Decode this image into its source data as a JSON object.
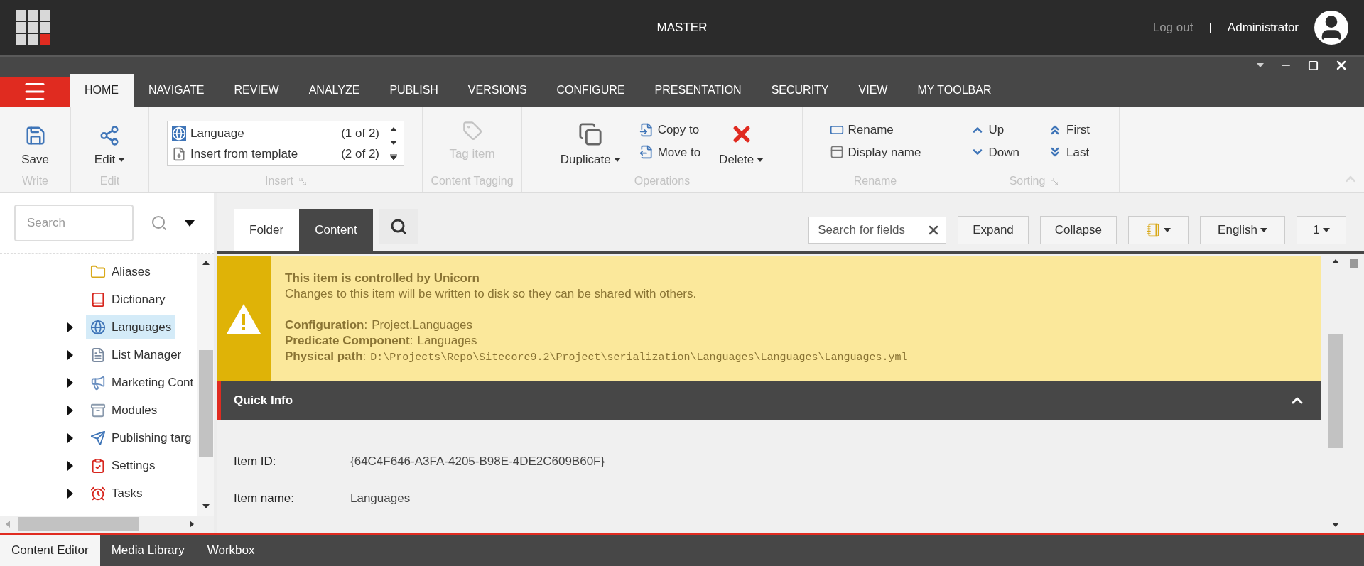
{
  "app_bar": {
    "title": "MASTER",
    "logout": "Log out",
    "separator": "|",
    "user": "Administrator"
  },
  "ribbon_tabs": [
    {
      "label": "HOME",
      "selected": true
    },
    {
      "label": "NAVIGATE",
      "selected": false
    },
    {
      "label": "REVIEW",
      "selected": false
    },
    {
      "label": "ANALYZE",
      "selected": false
    },
    {
      "label": "PUBLISH",
      "selected": false
    },
    {
      "label": "VERSIONS",
      "selected": false
    },
    {
      "label": "CONFIGURE",
      "selected": false
    },
    {
      "label": "PRESENTATION",
      "selected": false
    },
    {
      "label": "SECURITY",
      "selected": false
    },
    {
      "label": "VIEW",
      "selected": false
    },
    {
      "label": "MY TOOLBAR",
      "selected": false
    }
  ],
  "ribbon": {
    "write": {
      "label": "Write",
      "save": "Save"
    },
    "edit": {
      "label": "Edit",
      "edit": "Edit"
    },
    "insert": {
      "label": "Insert",
      "options": [
        {
          "name": "Language",
          "count": "(1 of 2)"
        },
        {
          "name": "Insert from template",
          "count": "(2 of 2)"
        }
      ]
    },
    "content_tagging": {
      "label": "Content Tagging",
      "tag_item": "Tag item",
      "disabled": true
    },
    "operations": {
      "label": "Operations",
      "duplicate": "Duplicate",
      "copy_to": "Copy to",
      "move_to": "Move to",
      "delete": "Delete"
    },
    "rename": {
      "label": "Rename",
      "rename": "Rename",
      "display_name": "Display name"
    },
    "sorting": {
      "label": "Sorting",
      "up": "Up",
      "down": "Down",
      "first": "First",
      "last": "Last"
    }
  },
  "tree": {
    "search_placeholder": "Search",
    "items": [
      {
        "label": "Aliases",
        "kind": "folder",
        "expandable": false,
        "selected": false
      },
      {
        "label": "Dictionary",
        "kind": "book",
        "expandable": false,
        "selected": false
      },
      {
        "label": "Languages",
        "kind": "globe",
        "expandable": true,
        "selected": true
      },
      {
        "label": "List Manager",
        "kind": "list",
        "expandable": true,
        "selected": false
      },
      {
        "label": "Marketing Cont",
        "kind": "megaphone",
        "expandable": true,
        "selected": false
      },
      {
        "label": "Modules",
        "kind": "jar",
        "expandable": true,
        "selected": false
      },
      {
        "label": "Publishing targ",
        "kind": "publish",
        "expandable": true,
        "selected": false
      },
      {
        "label": "Settings",
        "kind": "checklist",
        "expandable": true,
        "selected": false
      },
      {
        "label": "Tasks",
        "kind": "clock",
        "expandable": true,
        "selected": false
      }
    ]
  },
  "editor_tabs": [
    {
      "label": "Folder",
      "selected": false
    },
    {
      "label": "Content",
      "selected": true
    }
  ],
  "toolbar": {
    "field_search_placeholder": "Search for fields",
    "buttons": [
      "Expand",
      "Collapse"
    ],
    "language": "English",
    "version": "1"
  },
  "warning": {
    "title": "This item is controlled by Unicorn",
    "message": "Changes to this item will be written to disk so they can be shared with others.",
    "details": [
      {
        "label": "**Configuration**:",
        "value": "Project.Languages",
        "kind": "text"
      },
      {
        "label": "**Predicate Component**:",
        "value": "Languages",
        "kind": "text"
      },
      {
        "label": "**Physical path**:",
        "value": "D:\\Projects\\Repo\\Sitecore9.2\\Project\\serialization\\Languages\\Languages\\Languages.yml",
        "kind": "path"
      }
    ]
  },
  "quick_info": {
    "title": "Quick Info",
    "expanded": true,
    "fields": [
      {
        "label": "Item ID:",
        "value": "{64C4F646-A3FA-4205-B98E-4DE2C609B60F}"
      },
      {
        "label": "Item name:",
        "value": "Languages"
      }
    ]
  },
  "bottom_tabs": [
    {
      "label": "Content Editor",
      "selected": true
    },
    {
      "label": "Media Library",
      "selected": false
    },
    {
      "label": "Workbox",
      "selected": false
    }
  ]
}
